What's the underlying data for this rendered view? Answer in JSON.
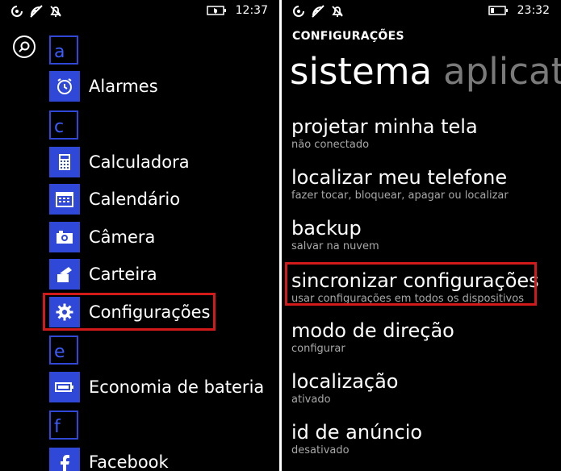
{
  "left": {
    "statusbar": {
      "time": "12:37"
    },
    "letters": [
      "a",
      "c",
      "e",
      "f"
    ],
    "apps": [
      {
        "label": "Alarmes",
        "icon": "alarm-clock-icon"
      },
      {
        "label": "Calculadora",
        "icon": "calculator-icon"
      },
      {
        "label": "Calendário",
        "icon": "calendar-icon"
      },
      {
        "label": "Câmera",
        "icon": "camera-icon"
      },
      {
        "label": "Carteira",
        "icon": "wallet-icon"
      },
      {
        "label": "Configurações",
        "icon": "gear-icon"
      },
      {
        "label": "Economia de bateria",
        "icon": "battery-icon"
      },
      {
        "label": "Facebook",
        "icon": "facebook-icon"
      }
    ]
  },
  "right": {
    "statusbar": {
      "time": "23:32"
    },
    "header": "CONFIGURAÇÕES",
    "pivot": {
      "active": "sistema",
      "next": "aplicat"
    },
    "settings": [
      {
        "title": "projetar minha tela",
        "subtitle": "não conectado"
      },
      {
        "title": "localizar meu telefone",
        "subtitle": "fazer tocar, bloquear, apagar ou localizar"
      },
      {
        "title": "backup",
        "subtitle": "salvar na nuvem"
      },
      {
        "title": "sincronizar configurações",
        "subtitle": "usar configurações em todos os dispositivos"
      },
      {
        "title": "modo de direção",
        "subtitle": "configurar"
      },
      {
        "title": "localização",
        "subtitle": "ativado"
      },
      {
        "title": "id de anúncio",
        "subtitle": "desativado"
      }
    ]
  },
  "colors": {
    "accent": "#2f48d8",
    "highlight": "#d31a1a",
    "background": "#000000"
  }
}
